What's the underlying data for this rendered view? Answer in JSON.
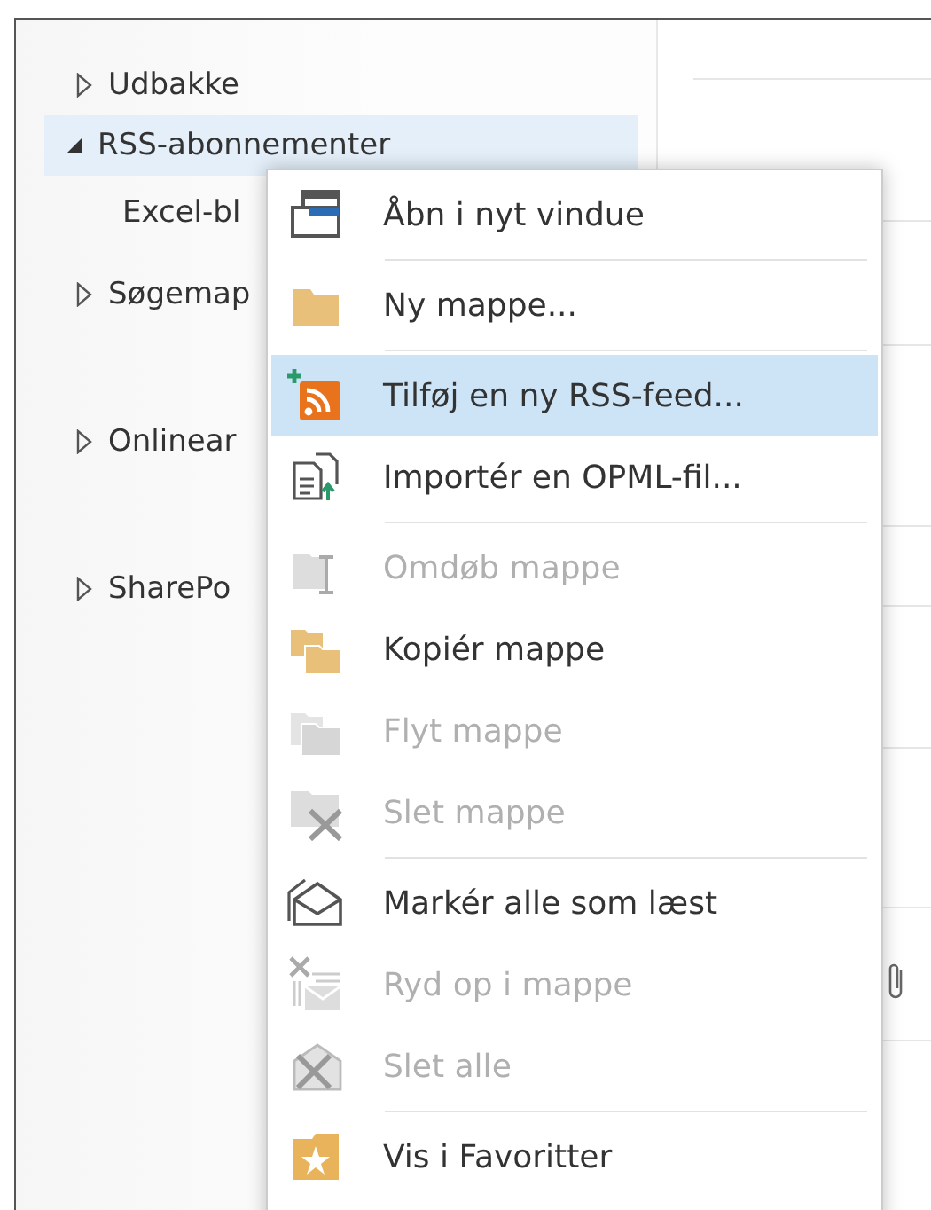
{
  "folders": [
    {
      "label": "Udbakke",
      "expanded": false,
      "selected": false
    },
    {
      "label": "RSS-abonnementer",
      "expanded": true,
      "selected": true,
      "children": [
        {
          "label": "Excel-bl"
        }
      ]
    },
    {
      "label": "Søgemap",
      "expanded": false,
      "selected": false
    },
    {
      "label": "Onlinear",
      "expanded": false,
      "selected": false
    },
    {
      "label": "SharePo",
      "expanded": false,
      "selected": false
    }
  ],
  "context_menu": [
    {
      "kind": "window",
      "label": "Åbn i nyt vindue",
      "disabled": false,
      "selected": false,
      "separator_below": true
    },
    {
      "kind": "folder",
      "label": "Ny mappe...",
      "disabled": false,
      "selected": false,
      "separator_below": true
    },
    {
      "kind": "rss",
      "label": "Tilføj en ny RSS-feed...",
      "disabled": false,
      "selected": true,
      "separator_below": false
    },
    {
      "kind": "import",
      "label": "Importér en OPML-fil...",
      "disabled": false,
      "selected": false,
      "separator_below": true
    },
    {
      "kind": "rename",
      "label": "Omdøb mappe",
      "disabled": true,
      "selected": false,
      "separator_below": false
    },
    {
      "kind": "copy",
      "label": "Kopiér mappe",
      "disabled": false,
      "selected": false,
      "separator_below": false
    },
    {
      "kind": "move",
      "label": "Flyt mappe",
      "disabled": true,
      "selected": false,
      "separator_below": false
    },
    {
      "kind": "delete-folder",
      "label": "Slet mappe",
      "disabled": true,
      "selected": false,
      "separator_below": true
    },
    {
      "kind": "mark-read",
      "label": "Markér alle som læst",
      "disabled": false,
      "selected": false,
      "separator_below": false
    },
    {
      "kind": "cleanup",
      "label": "Ryd op i mappe",
      "disabled": true,
      "selected": false,
      "separator_below": false
    },
    {
      "kind": "delete-all",
      "label": "Slet alle",
      "disabled": true,
      "selected": false,
      "separator_below": true
    },
    {
      "kind": "favorite",
      "label": "Vis i Favoritter",
      "disabled": false,
      "selected": false,
      "separator_below": false
    }
  ]
}
